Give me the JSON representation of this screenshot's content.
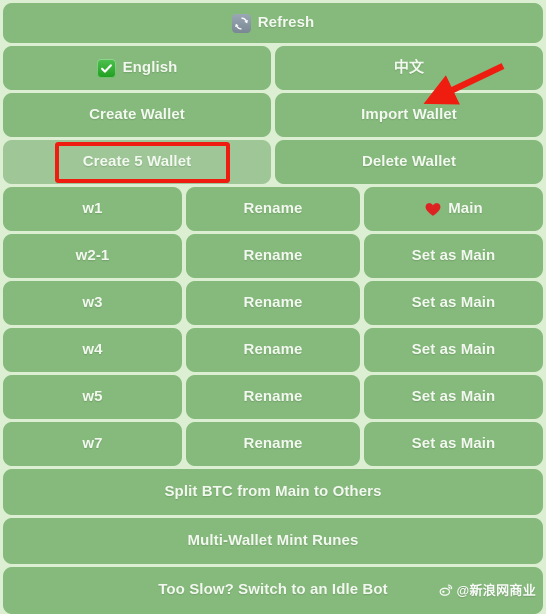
{
  "app": {
    "background_color": "#dcefd2",
    "button_color": "#86b97c",
    "button_hover_color": "#9ec696",
    "text_color": "#f2f8ef",
    "annotation_color": "#ee1d0f"
  },
  "toolbar": {
    "refresh_label": "Refresh",
    "refresh_icon": "refresh-icon"
  },
  "language": {
    "english_label": "English",
    "english_icon": "check-icon",
    "chinese_label": "中文"
  },
  "wallet_actions": {
    "create_wallet_label": "Create Wallet",
    "import_wallet_label": "Import Wallet",
    "create_5_wallet_label": "Create 5 Wallet",
    "delete_wallet_label": "Delete Wallet"
  },
  "wallets": [
    {
      "name": "w1",
      "rename_label": "Rename",
      "main_label": "Main",
      "is_main": true,
      "main_icon": "heart-icon"
    },
    {
      "name": "w2-1",
      "rename_label": "Rename",
      "main_label": "Set as Main",
      "is_main": false,
      "main_icon": ""
    },
    {
      "name": "w3",
      "rename_label": "Rename",
      "main_label": "Set as Main",
      "is_main": false,
      "main_icon": ""
    },
    {
      "name": "w4",
      "rename_label": "Rename",
      "main_label": "Set as Main",
      "is_main": false,
      "main_icon": ""
    },
    {
      "name": "w5",
      "rename_label": "Rename",
      "main_label": "Set as Main",
      "is_main": false,
      "main_icon": ""
    },
    {
      "name": "w7",
      "rename_label": "Rename",
      "main_label": "Set as Main",
      "is_main": false,
      "main_icon": ""
    }
  ],
  "footer_actions": {
    "split_btc_label": "Split BTC from Main to Others",
    "mint_runes_label": "Multi-Wallet Mint Runes",
    "idle_bot_label": "Too Slow? Switch to an Idle Bot"
  },
  "annotations": {
    "highlight_target": "Create 5 Wallet",
    "arrow_target": "Import Wallet"
  },
  "watermark": {
    "text": "@新浪网商业",
    "icon": "weibo-icon"
  }
}
